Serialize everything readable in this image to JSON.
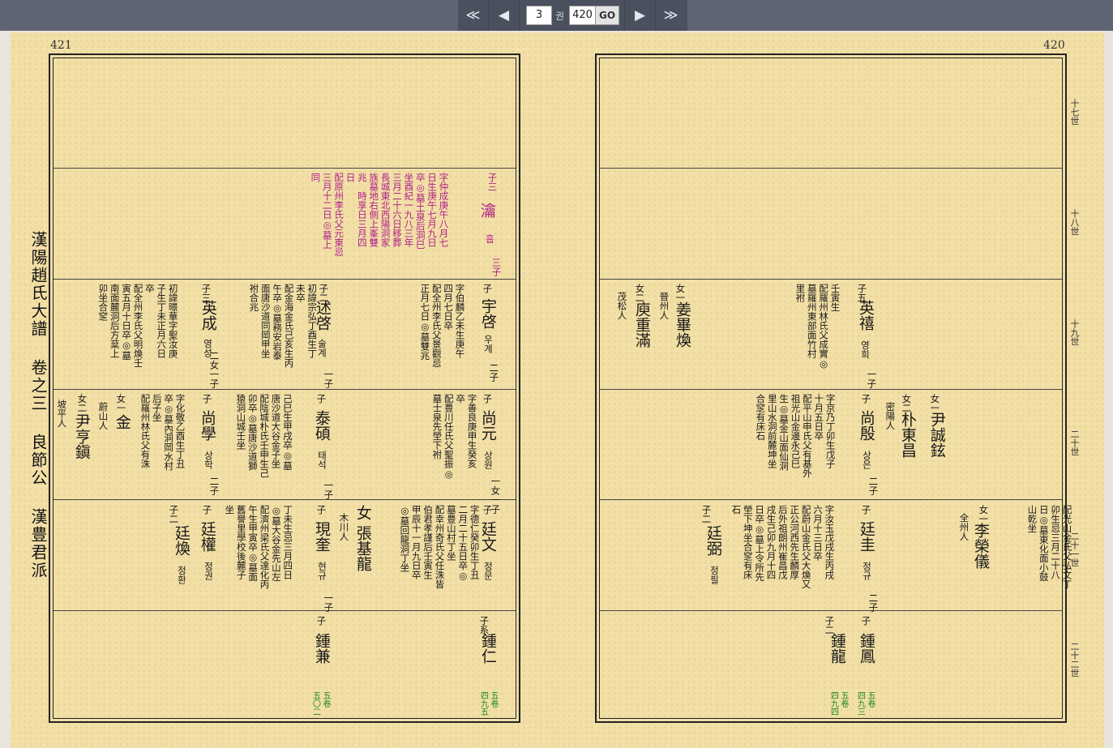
{
  "toolbar": {
    "first_label": "≪",
    "prev_label": "◀",
    "page_value": "3",
    "vol_suffix": "권",
    "total_pages": "420",
    "go_label": "GO",
    "next_label": "▶",
    "last_label": "≫"
  },
  "left_page": {
    "page_number": "421",
    "side_title": "漢陽趙氏大譜 卷之三 良節公 漢豊君派",
    "gen18": {
      "label": "子三",
      "name": "瀹",
      "hangul": "흡",
      "note": "三子",
      "record": "字仲成庚午八月七\n日生庚午七月九日\n卒◎墓土泉后洞巳\n坐酉紀一九八三年\n三月二十六日移葬\n長城東北西陽洞家\n族墓地右側上峯雙\n兆　時享日三月四\n日\n配原州李氏父元東忌\n三月十二日◎墓上\n同"
    },
    "gen19": [
      {
        "label": "子",
        "name": "宇啓",
        "hangul": "우계",
        "note": "二子",
        "record": "字伯麟乙未生庚午\n四月七日卒\n配全州李氏父景觀忌\n正月七日◎墓雙兆"
      },
      {
        "label": "子二",
        "name": "述啓",
        "hangul": "술계",
        "note": "一子",
        "record": "初諱宗弘丁酉生丁\n未卒\n配金海金氏己亥生丙\n午卒◎墓務安岩泰\n面唐沙道同岡甲坐\n祔合兆"
      },
      {
        "label": "子三",
        "name": "英成",
        "hangul": "영성",
        "note": "二女一子",
        "record": "初諱暻華字聖汝庚\n子生丁未正月六日\n卒\n配全州李氏父明煥壬\n寅五月十日卒◎墓\n南面麓洞后方棻上\n卯坐合窆"
      }
    ],
    "gen20": [
      {
        "label": "子",
        "name": "尚元",
        "hangul": "상원",
        "note": "一女一子",
        "record": "字善良庚申生癸亥\n卒\n配豊川任氏父聖振◎\n墓士泉先塋下祔"
      },
      {
        "label": "子",
        "name": "泰碩",
        "hangul": "태석",
        "note": "一子",
        "record": "己巳生甲戌卒◎墓\n唐沙道大谷金子坐\n配陰城朴氏壬申生己\n卯卒◎墓唐沙道獅\n猿洞山城壬坐"
      },
      {
        "label": "子",
        "name": "尚學",
        "hangul": "상학",
        "note": "二子",
        "record": "字化敬乙酉生丁丑\n卒◎墓內洞岡水村\n后子坐\n配羅州林氏父有洙"
      },
      {
        "label": "女一",
        "name": "金",
        "record": "蔚山人"
      },
      {
        "label": "女二",
        "name": "尹亨鎭",
        "record": "坡平人"
      }
    ],
    "gen21": [
      {
        "label": "子",
        "name": "廷文",
        "hangul": "정문",
        "note": "",
        "record": "字德仁癸卯生丁丑\n二月二十五日卒◎\n墓豊山村丁坐\n配幸州奇氏父任洙皆\n伯君孝謹后壬寅生\n甲辰十一月九日卒\n◎墓回龍洞丁坐"
      },
      {
        "label": "女",
        "name": "張基龍",
        "record": "木川人"
      },
      {
        "label": "子",
        "name": "現奎",
        "hangul": "현규",
        "note": "一子",
        "record": "丁未生忌三月四日\n◎墓大谷金先山左\n配濟州梁氏父達化丙\n午生甲寅卒◎墓面\n舊譽里學校後麓子\n坐"
      },
      {
        "label": "子",
        "name": "廷權",
        "hangul": "정권",
        "note": ""
      },
      {
        "label": "子二",
        "name": "廷煥",
        "hangul": "정환",
        "note": ""
      }
    ],
    "gen22": [
      {
        "label": "子系",
        "name": "鍾仁",
        "green": "五卷\n四九五"
      },
      {
        "label": "子",
        "name": "鍾兼",
        "green": "五卷\n五〇二"
      }
    ]
  },
  "right_page": {
    "page_number": "420",
    "generations": [
      "十七世",
      "十八世",
      "十九世",
      "二十世",
      "二十一世",
      "二十二世"
    ],
    "gen19": [
      {
        "label": "子五",
        "name": "英禧",
        "hangul": "영희",
        "note": "一子",
        "record": "壬寅生\n配羅州林氏父成實◎\n墓羅州東部面竹村\n里祔"
      },
      {
        "label": "女一",
        "name": "姜畢煥",
        "record": "晉州人"
      },
      {
        "label": "女二",
        "name": "庾重滿",
        "record": "茂松人"
      }
    ],
    "gen20": [
      {
        "label": "子",
        "name": "尚殷",
        "hangul": "상은",
        "note": "二子",
        "record": "字京乃丁卯生戊子\n十月五日卒\n配平山申氏父有基外\n祖光山金邊永己巳\n生◎墓金山面仙洞\n里山水洞前麓坤坐\n合窆有床石"
      },
      {
        "label": "女一",
        "name": "尹誠鉉",
        "record": ""
      },
      {
        "label": "女二",
        "name": "朴東昌",
        "record": "密陽人"
      }
    ],
    "gen21": [
      {
        "label": "女一",
        "name": "李榮儀",
        "record": "全州人",
        "extra": "配光山金氏父弘文丁\n卯生忌三月二十八\n日◎墓東化面小鼓\n山乾坐"
      },
      {
        "label": "子",
        "name": "廷圭",
        "hangul": "정규",
        "note": "二子",
        "record": "字汝玉戊戌生丙戌\n六月十三日卒\n配蔚山金氏父大煥又\n正公河西先生麟厚\n后外祖朗州崔昌戊\n戌生己卯九月十四\n日卒◎墓上令所先\n塋下坤坐合窆有床\n石"
      },
      {
        "label": "子二",
        "name": "廷弼",
        "hangul": "정필",
        "note": ""
      }
    ],
    "gen22": [
      {
        "label": "子",
        "name": "鍾鳳",
        "green": "五卷\n四九三"
      },
      {
        "label": "子二",
        "name": "鍾龍",
        "green": "五卷\n四九四"
      }
    ]
  }
}
